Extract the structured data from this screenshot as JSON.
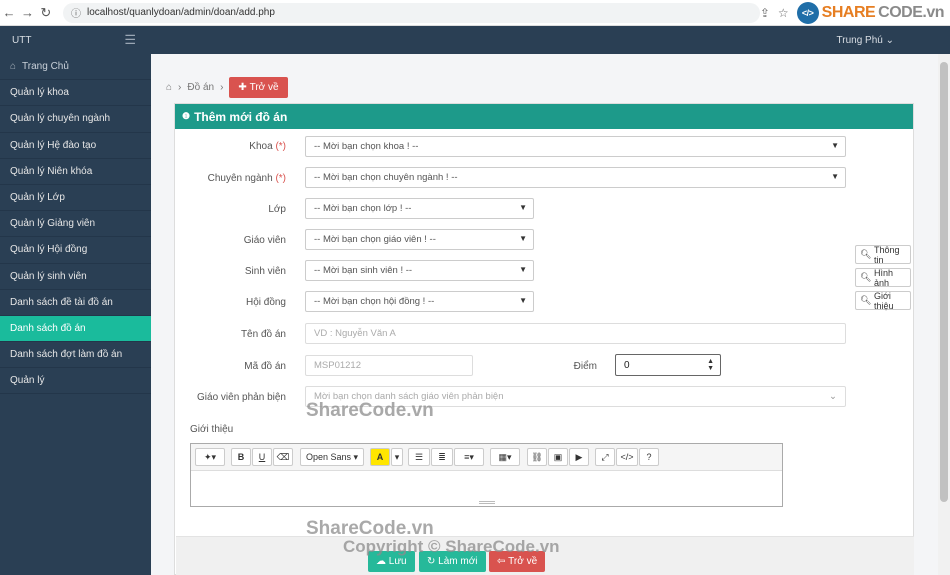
{
  "browser": {
    "url": "localhost/quanlydoan/admin/doan/add.php",
    "logo_text_a": "SHARE",
    "logo_text_b": "CODE.vn"
  },
  "header": {
    "brand": "UTT",
    "user": "Trung Phú"
  },
  "sidebar": {
    "items": [
      {
        "label": "Trang Chủ"
      },
      {
        "label": "Quản lý khoa"
      },
      {
        "label": "Quản lý chuyên ngành"
      },
      {
        "label": "Quản lý Hệ đào tạo"
      },
      {
        "label": "Quản lý Niên khóa"
      },
      {
        "label": "Quản lý Lớp"
      },
      {
        "label": "Quản lý Giảng viên"
      },
      {
        "label": "Quản lý Hội đồng"
      },
      {
        "label": "Quản lý sinh viên"
      },
      {
        "label": "Danh sách đề tài đồ án"
      },
      {
        "label": "Danh sách đồ án"
      },
      {
        "label": "Danh sách đợt làm đồ án"
      },
      {
        "label": "Quản lý"
      }
    ]
  },
  "breadcrumb": {
    "current": "Đồ án",
    "back_label": "Trở về"
  },
  "form": {
    "title": "Thêm mới đồ án",
    "required_mark": "(*)",
    "khoa": {
      "label": "Khoa",
      "value": "-- Mời bạn chọn khoa ! --"
    },
    "chuyen_nganh": {
      "label": "Chuyên ngành",
      "value": "-- Mời bạn chọn chuyên ngành ! --"
    },
    "lop": {
      "label": "Lớp",
      "value": "-- Mời bạn chọn lớp ! --"
    },
    "giao_vien": {
      "label": "Giáo viên",
      "value": "-- Mời bạn chọn giáo viên ! --"
    },
    "sinh_vien": {
      "label": "Sinh viên",
      "value": "-- Mời bạn sinh viên ! --"
    },
    "hoi_dong": {
      "label": "Hội đồng",
      "value": "-- Mời bạn chọn hội đồng ! --"
    },
    "ten_do_an": {
      "label": "Tên đồ án",
      "placeholder": "VD : Nguyễn Văn A"
    },
    "ma_do_an": {
      "label": "Mã đồ án",
      "placeholder": "MSP01212"
    },
    "diem": {
      "label": "Điểm",
      "value": "0"
    },
    "gv_phan_bien": {
      "label": "Giáo viên phản biện",
      "placeholder": "Mời bạn chọn danh sách giáo viên phản biện"
    },
    "gioi_thieu": {
      "label": "Giới thiệu"
    }
  },
  "side_buttons": {
    "thong_tin": "Thông tin",
    "hinh_anh": "Hình ảnh",
    "gioi_thieu": "Giới thiệu"
  },
  "editor": {
    "font": "Open Sans"
  },
  "footer": {
    "save": "Lưu",
    "reset": "Làm mới",
    "back": "Trở về"
  },
  "watermarks": {
    "mid": "ShareCode.vn",
    "bottom1": "ShareCode.vn",
    "bottom2": "Copyright © ShareCode.vn"
  }
}
